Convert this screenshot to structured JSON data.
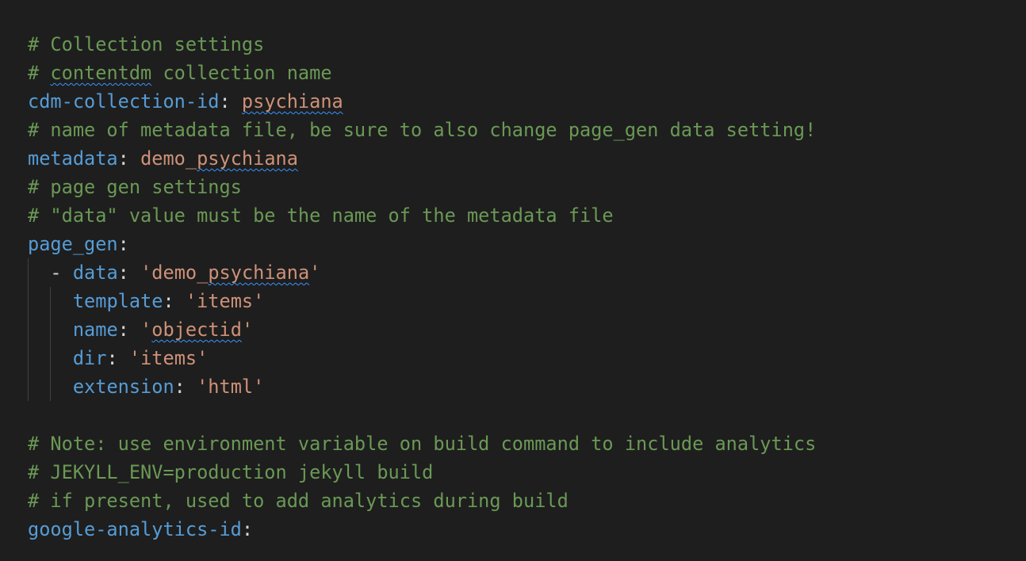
{
  "editor": {
    "lines": {
      "l1": {
        "comment": "# Collection settings"
      },
      "l2": {
        "hash": "# ",
        "word": "contentdm",
        "rest": " collection name"
      },
      "l3": {
        "key": "cdm-collection-id",
        "sep": ": ",
        "value": "psychiana"
      },
      "l4": {
        "comment": "# name of metadata file, be sure to also change page_gen data setting!"
      },
      "l5": {
        "key": "metadata",
        "sep": ": ",
        "value_plain": "demo_",
        "value_squiggle": "psychiana"
      },
      "l6": {
        "comment": "# page gen settings"
      },
      "l7": {
        "comment": "# \"data\" value must be the name of the metadata file"
      },
      "l8": {
        "key": "page_gen",
        "sep": ":"
      },
      "l9": {
        "indent": "  ",
        "dash": "- ",
        "key": "data",
        "sep": ": ",
        "value_plain": "'demo_",
        "value_squiggle": "psychiana",
        "value_end": "'"
      },
      "l10": {
        "indent": "    ",
        "key": "template",
        "sep": ": ",
        "value": "'items'"
      },
      "l11": {
        "indent": "    ",
        "key": "name",
        "sep": ": ",
        "value_start": "'",
        "value_squiggle": "objectid",
        "value_end": "'"
      },
      "l12": {
        "indent": "    ",
        "key": "dir",
        "sep": ": ",
        "value": "'items'"
      },
      "l13": {
        "indent": "    ",
        "key": "extension",
        "sep": ": ",
        "value": "'html'"
      },
      "l14": {
        "text": ""
      },
      "l15": {
        "comment": "# Note: use environment variable on build command to include analytics"
      },
      "l16": {
        "comment": "# JEKYLL_ENV=production jekyll build"
      },
      "l17": {
        "comment": "# if present, used to add analytics during build"
      },
      "l18": {
        "key": "google-analytics-id",
        "sep": ":"
      }
    }
  },
  "colors": {
    "background": "#1e1e1e",
    "comment": "#6a9955",
    "key": "#569cd6",
    "string": "#ce9178",
    "punctuation": "#d4d4d4",
    "spell_squiggle": "#3794ff",
    "indent_guide": "#404040"
  }
}
